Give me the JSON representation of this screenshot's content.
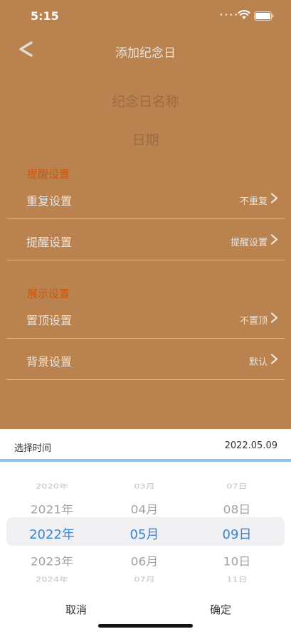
{
  "status_bar": {
    "time": "5:15"
  },
  "nav": {
    "title": "添加纪念日"
  },
  "form": {
    "name_placeholder": "纪念日名称",
    "date_label": "日期"
  },
  "sections": {
    "reminder": {
      "title": "提醒设置",
      "rows": [
        {
          "label": "重复设置",
          "value": "不重复"
        },
        {
          "label": "提醒设置",
          "value": "提醒设置"
        }
      ]
    },
    "display": {
      "title": "展示设置",
      "rows": [
        {
          "label": "置顶设置",
          "value": "不置顶"
        },
        {
          "label": "背景设置",
          "value": "默认"
        }
      ]
    }
  },
  "picker": {
    "label": "选择时间",
    "selected_value": "2022.05.09",
    "years": [
      "2020年",
      "2021年",
      "2022年",
      "2023年",
      "2024年"
    ],
    "months": [
      "03月",
      "04月",
      "05月",
      "06月",
      "07月"
    ],
    "days": [
      "07日",
      "08日",
      "09日",
      "10日",
      "11日"
    ],
    "cancel": "取消",
    "confirm": "确定"
  },
  "colors": {
    "background": "#b9824f",
    "section_title": "#c85a12",
    "picker_selected": "#3a86d4",
    "picker_divider": "#8fc3ec"
  }
}
